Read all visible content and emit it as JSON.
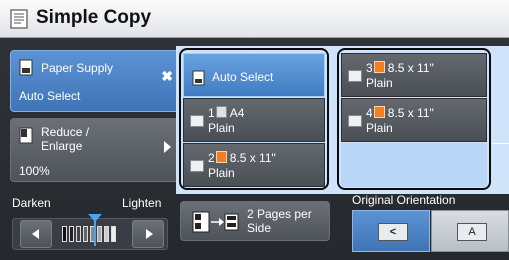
{
  "title": "Simple Copy",
  "paper_supply": {
    "label": "Paper Supply",
    "value": "Auto Select"
  },
  "reduce_enlarge": {
    "label_line1": "Reduce /",
    "label_line2": "Enlarge",
    "value": "100%"
  },
  "density": {
    "darken_label": "Darken",
    "lighten_label": "Lighten"
  },
  "pages_per_side": {
    "line1": "2 Pages per",
    "line2": "Side"
  },
  "orientation": {
    "label": "Original Orientation",
    "option_right_label": "A",
    "option_left_label": "A"
  },
  "trays": {
    "auto": {
      "label": "Auto Select"
    },
    "tray1": {
      "num": "1",
      "size": "A4",
      "type": "Plain"
    },
    "tray2": {
      "num": "2",
      "size": "8.5 x 11\"",
      "type": "Plain"
    },
    "tray3": {
      "num": "3",
      "size": "8.5 x 11\"",
      "type": "Plain"
    },
    "tray4": {
      "num": "4",
      "size": "8.5 x 11\"",
      "type": "Plain"
    }
  },
  "colors": {
    "accent_blue": "#3f7cc1",
    "paper_orange": "#f07f22",
    "slider_pointer": "#4aa3f0"
  }
}
